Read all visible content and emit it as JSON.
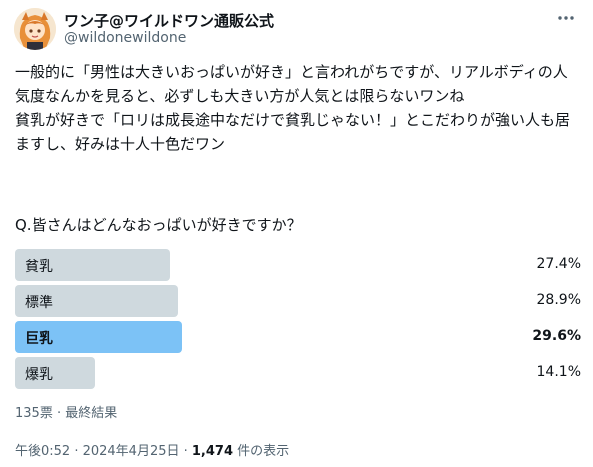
{
  "author": {
    "display_name": "ワン子@ワイルドワン通販公式",
    "handle": "@wildonewildone",
    "avatar_icon": "avatar-anime-girl-icon"
  },
  "more_icon": "more-dots-icon",
  "tweet": {
    "paragraph1": "一般的に「男性は大きいおっぱいが好き」と言われがちですが、リアルボディの人気度なんかを見ると、必ずしも大きい方が人気とは限らないワンね",
    "paragraph2": "貧乳が好きで「ロリは成長途中なだけで貧乳じゃない！」とこだわりが強い人も居ますし、好みは十人十色だワン"
  },
  "poll": {
    "question": "Q.皆さんはどんなおっぱいが好きですか？",
    "options": [
      {
        "label": "貧乳",
        "percent_text": "27.4%",
        "percent": 27.4,
        "winner": false
      },
      {
        "label": "標準",
        "percent_text": "28.9%",
        "percent": 28.9,
        "winner": false
      },
      {
        "label": "巨乳",
        "percent_text": "29.6%",
        "percent": 29.6,
        "winner": true
      },
      {
        "label": "爆乳",
        "percent_text": "14.1%",
        "percent": 14.1,
        "winner": false
      }
    ],
    "meta": "135票 · 最終結果"
  },
  "footer": {
    "timestamp": "午後0:52 · 2024年4月25日 · ",
    "views_count": "1,474",
    "views_suffix": " 件の表示"
  },
  "colors": {
    "bar": "#cfd9de",
    "winner_bar": "#7cc2f6",
    "secondary_text": "#536471",
    "primary_text": "#0f1419"
  }
}
